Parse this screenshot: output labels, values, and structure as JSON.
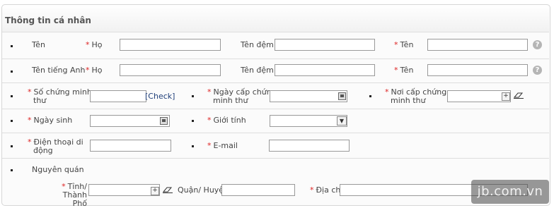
{
  "section": {
    "title": "Thông tin cá nhân"
  },
  "name_row": {
    "label": "Tên",
    "last": "Họ",
    "middle": "Tên đệm",
    "first": "Tên",
    "help": "?"
  },
  "english_name_row": {
    "label": "Tên tiếng Anh",
    "last": "Họ",
    "middle": "Tên đệm",
    "first": "Tên",
    "help": "?"
  },
  "id_row": {
    "id_number_label_1": "Số chứng minh",
    "id_number_label_2": "thư",
    "check_label": "[Check]",
    "issue_date_label_1": "Ngày cấp chứng",
    "issue_date_label_2": "minh thư",
    "issue_place_label_1": "Nơi cấp chứng",
    "issue_place_label_2": "minh thư",
    "plus": "+"
  },
  "birth_row": {
    "birthday_label": "Ngày sinh",
    "gender_label": "Giới tính"
  },
  "contact_row": {
    "phone_label_1": "Điện thoại di",
    "phone_label_2": "động",
    "email_label": "E-mail"
  },
  "origin_row": {
    "label": "Nguyên quán",
    "province_label_1": "Tỉnh/ Thành",
    "province_label_2": "Phố",
    "district_label": "Quận/ Huyện",
    "address_label": "Địa chỉ",
    "plus": "+"
  },
  "required_mark": "*",
  "watermark": "jb.com.vn"
}
